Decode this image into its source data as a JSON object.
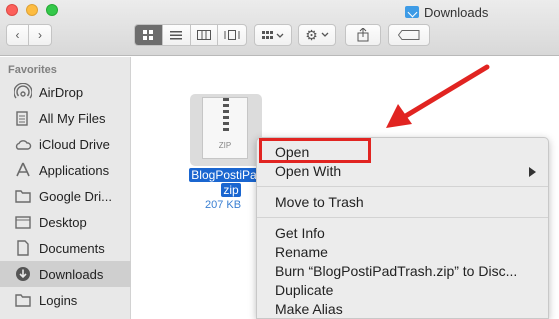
{
  "window": {
    "title": "Downloads"
  },
  "toolbar": {
    "back_icon": "chevron-left-icon",
    "forward_icon": "chevron-right-icon",
    "views": [
      "icon-view-icon",
      "list-view-icon",
      "column-view-icon",
      "coverflow-view-icon"
    ],
    "arrange_icon": "arrange-grid-icon",
    "action_icon": "gear-icon",
    "share_icon": "share-icon",
    "tag_icon": "tag-icon"
  },
  "sidebar": {
    "heading": "Favorites",
    "items": [
      {
        "label": "AirDrop",
        "icon": "airdrop-icon"
      },
      {
        "label": "All My Files",
        "icon": "all-files-icon"
      },
      {
        "label": "iCloud Drive",
        "icon": "cloud-icon"
      },
      {
        "label": "Applications",
        "icon": "applications-icon"
      },
      {
        "label": "Google Dri...",
        "icon": "folder-icon"
      },
      {
        "label": "Desktop",
        "icon": "desktop-icon"
      },
      {
        "label": "Documents",
        "icon": "documents-icon"
      },
      {
        "label": "Downloads",
        "icon": "downloads-icon",
        "selected": true
      },
      {
        "label": "Logins",
        "icon": "folder-icon"
      }
    ]
  },
  "file": {
    "icon_label": "ZIP",
    "name_line1": "BlogPostiPadT",
    "name_line2": "zip",
    "size": "207 KB"
  },
  "context_menu": {
    "items": {
      "open": "Open",
      "open_with": "Open With",
      "move_to_trash": "Move to Trash",
      "get_info": "Get Info",
      "rename": "Rename",
      "burn": "Burn “BlogPostiPadTrash.zip” to Disc...",
      "duplicate": "Duplicate",
      "make_alias": "Make Alias"
    }
  },
  "annotation": {
    "highlight_color": "#e12421",
    "arrow_color": "#e12421"
  }
}
